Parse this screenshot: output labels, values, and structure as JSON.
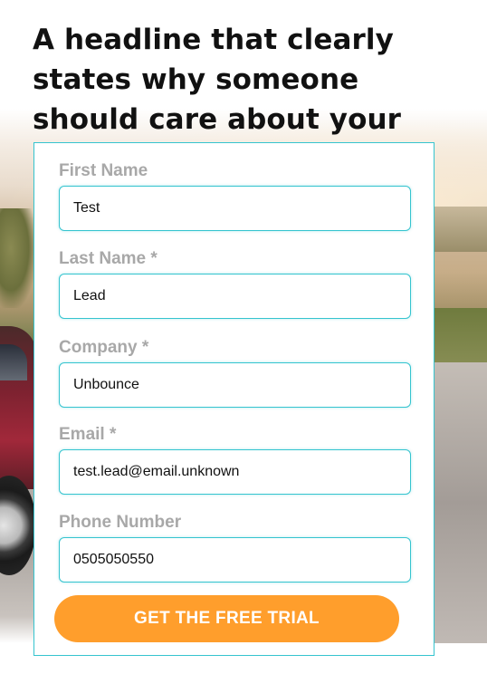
{
  "headline": "A headline that clearly states why someone should care about your product/service.",
  "form": {
    "fields": [
      {
        "label": "First Name",
        "value": "Test"
      },
      {
        "label": "Last Name *",
        "value": "Lead"
      },
      {
        "label": "Company *",
        "value": "Unbounce"
      },
      {
        "label": "Email *",
        "value": "test.lead@email.unknown"
      },
      {
        "label": "Phone Number",
        "value": "0505050550"
      }
    ],
    "submit_label": "GET THE FREE TRIAL"
  },
  "colors": {
    "accent": "#35c4cf",
    "cta": "#ff9e2c",
    "label": "#a8a8a8"
  }
}
